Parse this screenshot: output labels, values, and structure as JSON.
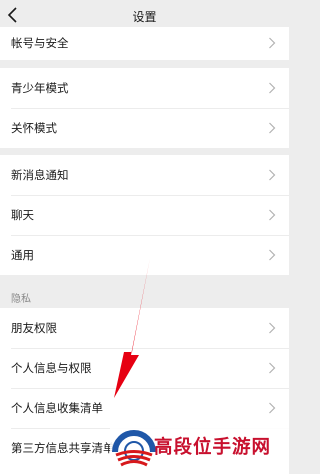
{
  "nav": {
    "title": "设置",
    "back_icon": "chevron-left-icon"
  },
  "groups": [
    {
      "items": [
        {
          "label": "帐号与安全"
        }
      ]
    },
    {
      "items": [
        {
          "label": "青少年模式"
        },
        {
          "label": "关怀模式"
        }
      ]
    },
    {
      "items": [
        {
          "label": "新消息通知"
        },
        {
          "label": "聊天"
        },
        {
          "label": "通用"
        }
      ]
    },
    {
      "header": "隐私",
      "items": [
        {
          "label": "朋友权限"
        },
        {
          "label": "个人信息与权限"
        },
        {
          "label": "个人信息收集清单"
        },
        {
          "label": "第三方信息共享清单"
        }
      ]
    }
  ],
  "watermark": {
    "text": "高段位手游网",
    "logo": "watermark-logo"
  },
  "colors": {
    "background": "#ededed",
    "row": "#ffffff",
    "arrow": "#e60012",
    "watermark": "#c8102e"
  }
}
